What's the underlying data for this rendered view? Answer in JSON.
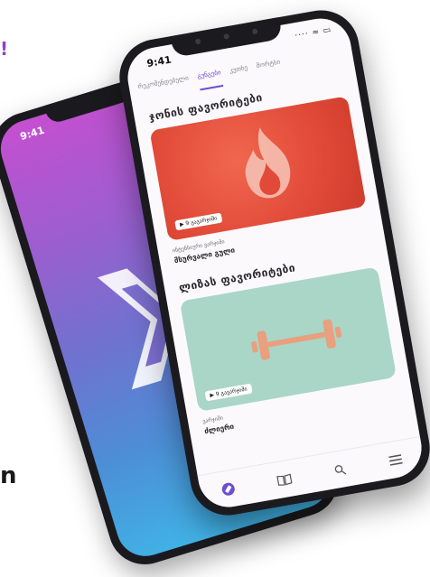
{
  "edge": {
    "top_left": "!",
    "bottom_left": "n"
  },
  "back_phone": {
    "status_time": "9:41"
  },
  "front_phone": {
    "status_time": "9:41",
    "status_icons": "···· ≈ ▭",
    "tabs": [
      {
        "label": "რეკომენდებული",
        "active": false
      },
      {
        "label": "გუნგები",
        "active": true
      },
      {
        "label": "კუთხე",
        "active": false
      },
      {
        "label": "შორტსი",
        "active": false
      }
    ],
    "section1": {
      "title": "ჯონის ფავორიტები",
      "badge": "▶ 9 გავარჯიში",
      "caption_small": "ინტენსიური ვარჯიში",
      "caption_name": "მსურვალი გული"
    },
    "section2": {
      "title": "ლიზას ფავორიტები",
      "badge": "▶ 9 გავარჯიში",
      "caption_small": "ვარჯიში",
      "caption_name": "ძლიერი"
    },
    "nav": [
      {
        "icon": "compass-icon"
      },
      {
        "icon": "book-icon"
      },
      {
        "icon": "search-icon"
      },
      {
        "icon": "menu-icon"
      }
    ]
  },
  "colors": {
    "accent": "#6a4fd1",
    "red_card": "#e14a38",
    "teal_card": "#a9d6c7",
    "dumbbell": "#e8a07e",
    "edge_accent": "#8e44c9"
  }
}
